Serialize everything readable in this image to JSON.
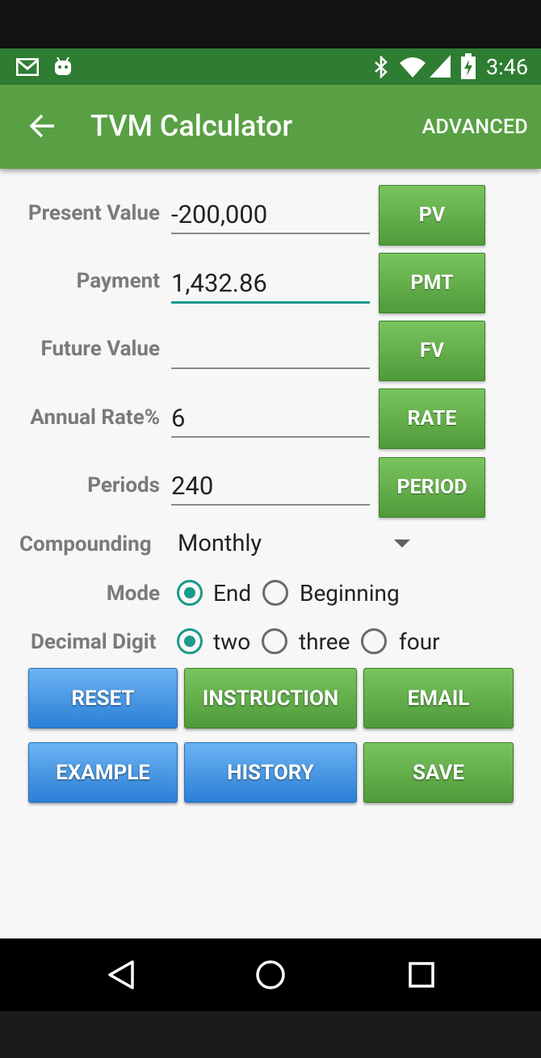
{
  "status_bar": {
    "time": "3:46",
    "left_icons": [
      "gmail-icon",
      "android-icon"
    ],
    "right_icons": [
      "bluetooth-icon",
      "wifi-icon",
      "signal-icon",
      "battery-charging-icon"
    ]
  },
  "app_bar": {
    "title": "TVM Calculator",
    "action": "ADVANCED"
  },
  "fields": {
    "present_value": {
      "label": "Present Value",
      "value": "-200,000",
      "button": "PV"
    },
    "payment": {
      "label": "Payment",
      "value": "1,432.86",
      "button": "PMT"
    },
    "future_value": {
      "label": "Future Value",
      "value": "",
      "button": "FV"
    },
    "annual_rate": {
      "label": "Annual Rate%",
      "value": "6",
      "button": "RATE"
    },
    "periods": {
      "label": "Periods",
      "value": "240",
      "button": "PERIOD"
    }
  },
  "compounding": {
    "label": "Compounding",
    "selected": "Monthly"
  },
  "mode": {
    "label": "Mode",
    "options": [
      "End",
      "Beginning"
    ],
    "selected": "End"
  },
  "decimal": {
    "label": "Decimal Digit",
    "options": [
      "two",
      "three",
      "four"
    ],
    "selected": "two"
  },
  "buttons": {
    "reset": "RESET",
    "instruction": "INSTRUCTION",
    "email": "EMAIL",
    "example": "EXAMPLE",
    "history": "HISTORY",
    "save": "SAVE"
  },
  "colors": {
    "status_bar": "#2f7d32",
    "app_bar": "#58a043",
    "accent": "#1a9a88",
    "green_button": "#5fae48",
    "blue_button": "#3a8de0"
  }
}
